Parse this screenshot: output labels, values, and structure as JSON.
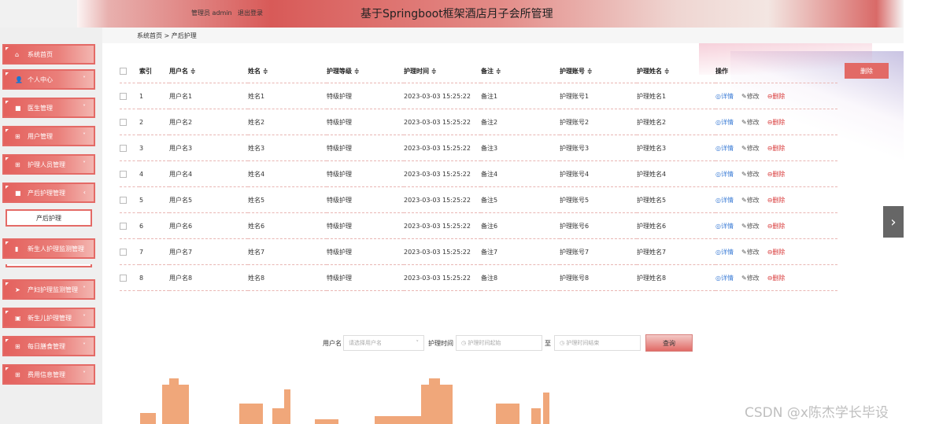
{
  "header": {
    "admin_text": "管理员 admin",
    "logout": "退出登录",
    "title": "基于Springboot框架酒店月子会所管理"
  },
  "breadcrumb": "系统首页 > 产后护理",
  "sidebar": {
    "items": [
      {
        "icon": "home-icon",
        "glyph": "⌂",
        "label": "系统首页",
        "arrow": ""
      },
      {
        "icon": "user-icon",
        "glyph": "👤",
        "label": "个人中心",
        "arrow": "˅"
      },
      {
        "icon": "doc-icon",
        "glyph": "■",
        "label": "医生管理",
        "arrow": "˅"
      },
      {
        "icon": "grid-icon",
        "glyph": "⊞",
        "label": "用户管理",
        "arrow": "˅"
      },
      {
        "icon": "grid-icon",
        "glyph": "⊞",
        "label": "护理人员管理",
        "arrow": "˅"
      },
      {
        "icon": "doc-icon",
        "glyph": "■",
        "label": "产后护理管理",
        "arrow": "‹"
      },
      {
        "icon": "chart-icon",
        "glyph": "▮",
        "label": "新生人护理监测管理",
        "arrow": "˅"
      },
      {
        "icon": "send-icon",
        "glyph": "➤",
        "label": "产妇护理监测管理",
        "arrow": "˅"
      },
      {
        "icon": "calendar-icon",
        "glyph": "▣",
        "label": "新生儿护理管理",
        "arrow": "˅"
      },
      {
        "icon": "grid-icon",
        "glyph": "⊞",
        "label": "每日膳食管理",
        "arrow": "˅"
      },
      {
        "icon": "grid-icon",
        "glyph": "⊞",
        "label": "费用信息管理",
        "arrow": "˅"
      }
    ],
    "submenu_active": "产后护理"
  },
  "table": {
    "headers": [
      "索引",
      "用户名 ≑",
      "姓名 ≑",
      "护理等级 ≑",
      "护理时间 ≑",
      "备注 ≑",
      "护理账号 ≑",
      "护理姓名 ≑",
      "操作"
    ],
    "rows": [
      [
        "1",
        "用户名1",
        "姓名1",
        "特级护理",
        "2023-03-03 15:25:22",
        "备注1",
        "护理账号1",
        "护理姓名1"
      ],
      [
        "2",
        "用户名2",
        "姓名2",
        "特级护理",
        "2023-03-03 15:25:22",
        "备注2",
        "护理账号2",
        "护理姓名2"
      ],
      [
        "3",
        "用户名3",
        "姓名3",
        "特级护理",
        "2023-03-03 15:25:22",
        "备注3",
        "护理账号3",
        "护理姓名3"
      ],
      [
        "4",
        "用户名4",
        "姓名4",
        "特级护理",
        "2023-03-03 15:25:22",
        "备注4",
        "护理账号4",
        "护理姓名4"
      ],
      [
        "5",
        "用户名5",
        "姓名5",
        "特级护理",
        "2023-03-03 15:25:22",
        "备注5",
        "护理账号5",
        "护理姓名5"
      ],
      [
        "6",
        "用户名6",
        "姓名6",
        "特级护理",
        "2023-03-03 15:25:22",
        "备注6",
        "护理账号6",
        "护理姓名6"
      ],
      [
        "7",
        "用户名7",
        "姓名7",
        "特级护理",
        "2023-03-03 15:25:22",
        "备注7",
        "护理账号7",
        "护理姓名7"
      ],
      [
        "8",
        "用户名8",
        "姓名8",
        "特级护理",
        "2023-03-03 15:25:22",
        "备注8",
        "护理账号8",
        "护理姓名8"
      ]
    ],
    "ops": {
      "detail": "◎详情",
      "edit": "✎修改",
      "delete": "⊖删除"
    }
  },
  "top_delete": "删除",
  "search": {
    "username_label": "用户名",
    "username_placeholder": "请选择用户名",
    "time_label": "护理时间",
    "time_start_placeholder": "◷ 护理时间起始",
    "to_label": "至",
    "time_end_placeholder": "◷ 护理时间结束",
    "button": "查询"
  },
  "watermark": "CSDN @x陈杰学长毕设",
  "colors": {
    "accent": "#e26a66",
    "link_blue": "#3a7bd5",
    "delete_red": "#d83a3a"
  }
}
